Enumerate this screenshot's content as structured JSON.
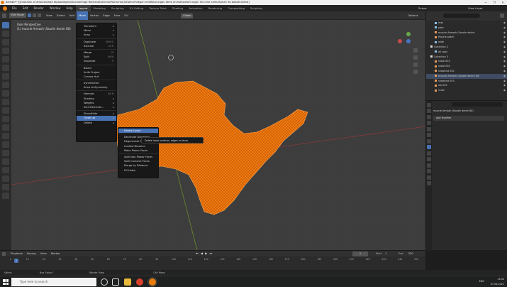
{
  "window": {
    "title": "Blender* [\\\\Evolution of atlantas\\lead atpalosiegani\\Sochalrenge Rochanta\\Animal\\Rochanta\\3D\\bhutmdegan md\\Ifotal organ atme animal\\sorbet organ full ume animal\\ahan 3d bobakt.blend]",
    "controls": [
      "—",
      "❐",
      "✕"
    ]
  },
  "topmenu": {
    "items": [
      "File",
      "Edit",
      "Render",
      "Window",
      "Help"
    ],
    "workspaces": [
      "Layout",
      "Modeling",
      "Sculpting",
      "UV Editing",
      "Texture Paint",
      "Shading",
      "Animation",
      "Rendering",
      "Compositing",
      "Scripting"
    ],
    "active_workspace": "Layout",
    "scene_label": "Scene",
    "view_layer_label": "View Layer"
  },
  "viewport_header": {
    "mode": "Edit Mode",
    "menus": [
      "View",
      "Select",
      "Add",
      "Mesh",
      "Vertex",
      "Edge",
      "Face",
      "UV"
    ],
    "active_menu": "Mesh",
    "transform": "Global",
    "options": "Options"
  },
  "viewport": {
    "view_name": "User Perspective",
    "object_name": "(1) muscle Armash (Saudin decim 80)"
  },
  "mesh_menu": {
    "items": [
      {
        "label": "Transform",
        "arrow": "▸"
      },
      {
        "label": "Mirror",
        "arrow": "▸"
      },
      {
        "label": "Snap",
        "arrow": "▸"
      },
      {
        "sep": true
      },
      {
        "label": "Duplicate",
        "shortcut": "Shift D"
      },
      {
        "label": "Extrude",
        "shortcut": "Alt E"
      },
      {
        "sep": true
      },
      {
        "label": "Merge",
        "shortcut": "M"
      },
      {
        "label": "Split",
        "shortcut": "Alt M"
      },
      {
        "label": "Separate",
        "shortcut": "P"
      },
      {
        "sep": true
      },
      {
        "label": "Bisect"
      },
      {
        "label": "Knife Project"
      },
      {
        "label": "Convex Hull"
      },
      {
        "sep": true
      },
      {
        "label": "Symmetrize"
      },
      {
        "label": "Snap to Symmetry"
      },
      {
        "sep": true
      },
      {
        "label": "Normals",
        "shortcut": "Alt N"
      },
      {
        "label": "Shading",
        "arrow": "▸"
      },
      {
        "label": "Weights",
        "arrow": "▸"
      },
      {
        "label": "Sort Elements...",
        "arrow": "▸"
      },
      {
        "sep": true
      },
      {
        "label": "Show/Hide",
        "arrow": "▸"
      },
      {
        "label": "Clean Up",
        "arrow": "▸",
        "highlight": true
      },
      {
        "label": "Delete",
        "arrow": "▸"
      }
    ]
  },
  "cleanup_menu": {
    "items": [
      {
        "label": "Delete Loose",
        "highlight": true
      },
      {
        "sep": true
      },
      {
        "label": "Decimate Geometry"
      },
      {
        "label": "Degenerate Dissolve"
      },
      {
        "label": "Limited Dissolve"
      },
      {
        "label": "Make Planar Faces"
      },
      {
        "sep": true
      },
      {
        "label": "Split Non-Planar Faces"
      },
      {
        "label": "Split Concave Faces"
      },
      {
        "label": "Merge by Distance"
      },
      {
        "label": "Fill Holes"
      }
    ]
  },
  "tooltip": "Delete loose vertices, edges or faces.",
  "outliner": {
    "items": [
      {
        "label": "mas",
        "color": "#8ac1e8"
      },
      {
        "label": "pata",
        "color": "#8ac1e8"
      },
      {
        "label": "muscle Armash (Saudin decim",
        "color": "#e89b5a"
      },
      {
        "label": "Muscle patch",
        "color": "#e89b5a"
      },
      {
        "label": "wide",
        "color": "#8ac1e8"
      },
      {
        "label": "Collection 2",
        "color": "#dddddd"
      },
      {
        "label": "all copy",
        "color": "#8ac1e8"
      },
      {
        "label": "Collection 3",
        "color": "#dddddd"
      },
      {
        "label": "shaal 003",
        "color": "#e89b5a"
      },
      {
        "label": "shaal 004",
        "color": "#e89b5a"
      },
      {
        "label": "shaalsnd 002",
        "color": "#e89b5a"
      },
      {
        "label": "muscle Armash (Saudin decim 80)",
        "color": "#e89b5a",
        "selected": true
      },
      {
        "label": "shaalsnd 003",
        "color": "#e89b5a"
      },
      {
        "label": "wo 003",
        "color": "#e89b5a"
      },
      {
        "label": "Cube",
        "color": "#e89b5a"
      }
    ]
  },
  "properties": {
    "object_label": "muscle Armash (Saudin decim 80)",
    "add_modifier": "Add Modifier"
  },
  "timeline": {
    "menus": [
      "Playback",
      "Keying",
      "View",
      "Marker"
    ],
    "ticks": [
      "0",
      "10",
      "20",
      "30",
      "40",
      "50",
      "60",
      "70",
      "80",
      "90",
      "100",
      "110",
      "120",
      "130",
      "140",
      "150",
      "160",
      "170",
      "180",
      "190",
      "200",
      "210",
      "220",
      "230",
      "240",
      "250"
    ],
    "current_frame": "1",
    "start_label": "Start",
    "start_value": "1",
    "end_label": "End",
    "end_value": "250"
  },
  "statusbar": {
    "items": [
      "Select",
      "Box Select",
      "Rotate View",
      "Call Menu"
    ]
  },
  "taskbar": {
    "search_placeholder": "Type here to search",
    "lang": "ENG",
    "time": "13:40",
    "date": "07.04.2021"
  },
  "colors": {
    "mesh": "#f07a10",
    "accent": "#4772b3"
  }
}
